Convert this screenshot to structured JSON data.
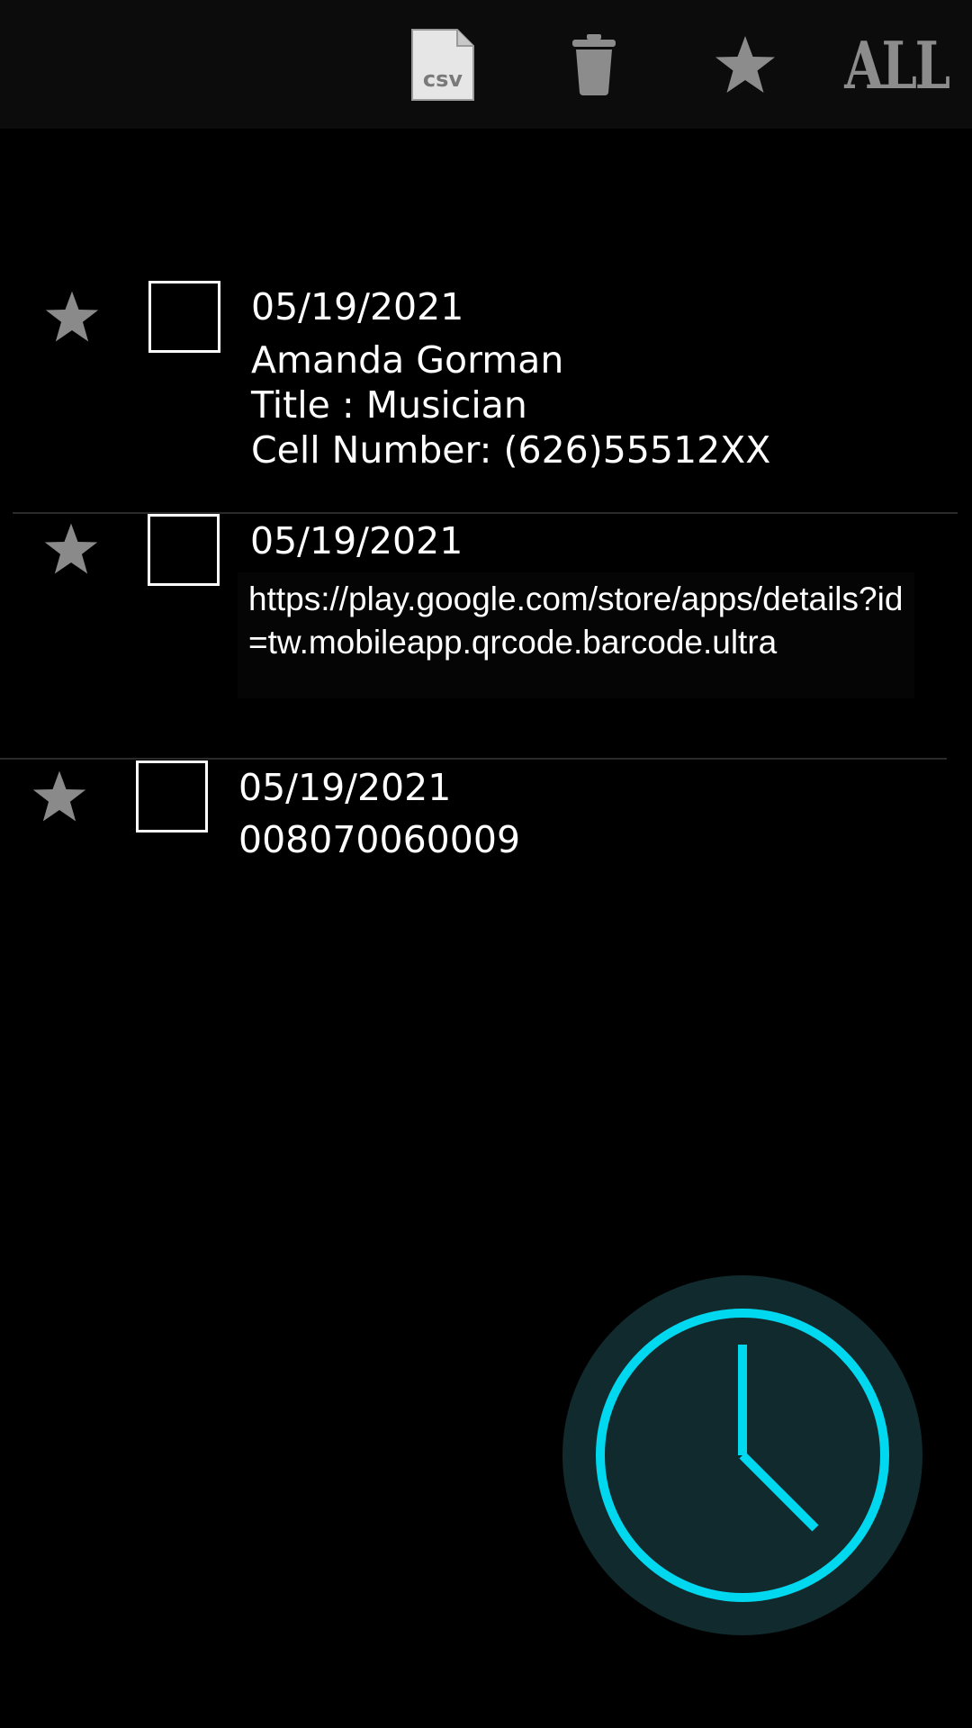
{
  "toolbar": {
    "csv_label": "csv",
    "all_label": "ALL",
    "csv_icon": "csv-file-icon",
    "delete_icon": "trash-icon",
    "favorite_icon": "star-icon"
  },
  "items": [
    {
      "date": "05/19/2021",
      "name": "Amanda Gorman",
      "title": "Title : Musician",
      "cell": "Cell Number: (626)55512XX"
    },
    {
      "date": "05/19/2021",
      "url": "https://play.google.com/store/apps/details?id=tw.mobileapp.qrcode.barcode.ultra"
    },
    {
      "date": "05/19/2021",
      "code": "008070060009"
    }
  ],
  "fab": {
    "icon": "clock-icon",
    "accent_color": "#00d8f0",
    "background_color": "#102a2e"
  }
}
